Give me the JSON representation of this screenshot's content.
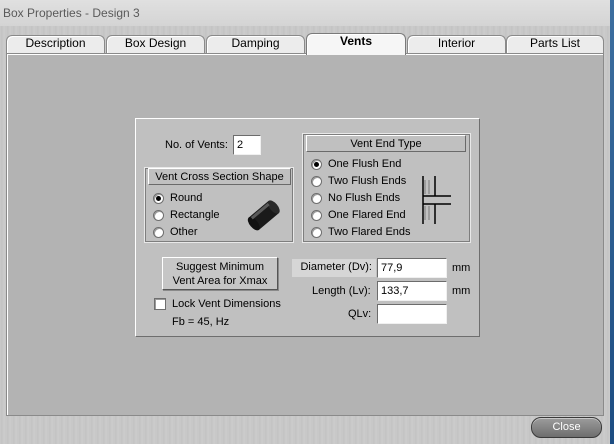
{
  "window": {
    "title": "Box Properties - Design 3"
  },
  "tabs": [
    {
      "label": "Description"
    },
    {
      "label": "Box Design"
    },
    {
      "label": "Damping"
    },
    {
      "label": "Vents",
      "active": true
    },
    {
      "label": "Interior"
    },
    {
      "label": "Parts List"
    }
  ],
  "vents": {
    "num_label": "No. of Vents:",
    "num_value": "2",
    "cross_section": {
      "title": "Vent Cross Section Shape",
      "options": [
        "Round",
        "Rectangle",
        "Other"
      ],
      "selected": "Round"
    },
    "end_type": {
      "title": "Vent End Type",
      "options": [
        "One Flush End",
        "Two Flush Ends",
        "No Flush Ends",
        "One Flared End",
        "Two Flared Ends"
      ],
      "selected": "One Flush End"
    },
    "suggest_button_line1": "Suggest Minimum",
    "suggest_button_line2": "Vent Area for Xmax",
    "lock_label": "Lock Vent Dimensions",
    "lock_checked": false,
    "fb_text": "Fb = 45, Hz",
    "diameter_label": "Diameter (Dv):",
    "diameter_value": "77,9",
    "diameter_unit": "mm",
    "length_label": "Length (Lv):",
    "length_value": "133,7",
    "length_unit": "mm",
    "qlv_label": "QLv:",
    "qlv_value": ""
  },
  "footer": {
    "close_label": "Close"
  },
  "icons": {
    "cylinder": "cylinder-icon",
    "flush_end": "flush-end-icon"
  }
}
